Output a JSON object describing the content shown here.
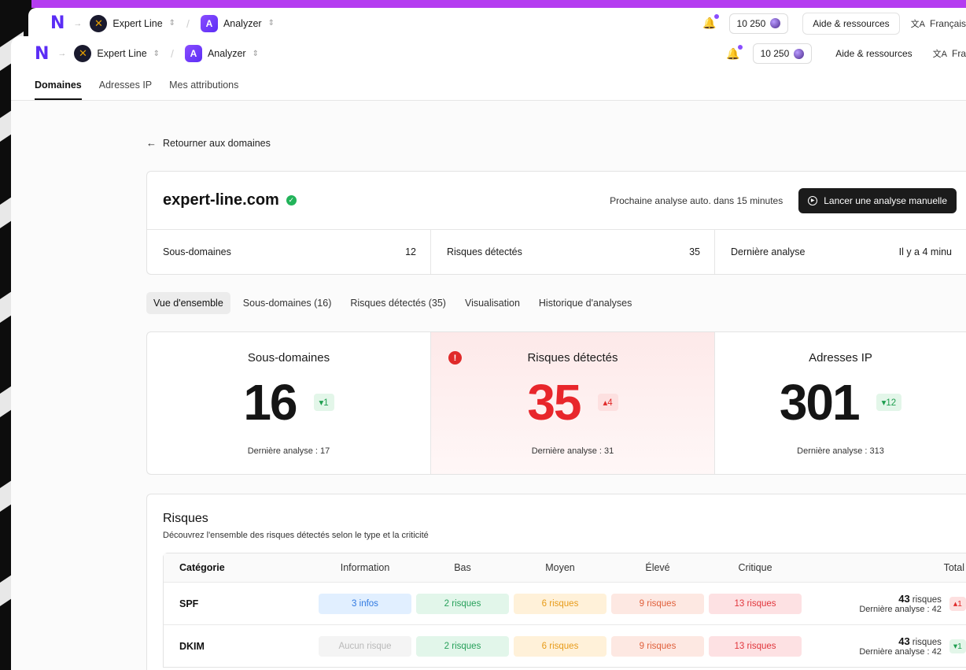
{
  "topbar": {
    "org": "Expert Line",
    "app": "Analyzer",
    "credits": "10 250",
    "help": "Aide & ressources",
    "language": "Français",
    "language_cut": "Fra"
  },
  "nav": {
    "tabs": [
      "Domaines",
      "Adresses IP",
      "Mes attributions"
    ]
  },
  "back_link": "Retourner aux domaines",
  "domain": {
    "name": "expert-line.com",
    "next_analysis": "Prochaine analyse auto. dans 15 minutes",
    "run_button": "Lancer une analyse manuelle",
    "stats": [
      {
        "label": "Sous-domaines",
        "value": "12"
      },
      {
        "label": "Risques détectés",
        "value": "35"
      },
      {
        "label": "Dernière analyse",
        "value": "Il y a 4 minu"
      }
    ]
  },
  "subtabs": [
    "Vue d'ensemble",
    "Sous-domaines (16)",
    "Risques détectés (35)",
    "Visualisation",
    "Historique d'analyses"
  ],
  "kpis": [
    {
      "title": "Sous-domaines",
      "value": "16",
      "delta": "▾1",
      "foot": "Dernière analyse : 17"
    },
    {
      "title": "Risques détectés",
      "value": "35",
      "delta": "▴4",
      "foot": "Dernière analyse : 31"
    },
    {
      "title": "Adresses IP",
      "value": "301",
      "delta": "▾12",
      "foot": "Dernière analyse : 313"
    }
  ],
  "risks": {
    "title": "Risques",
    "subtitle": "Découvrez l'ensemble des risques détectés selon le type et la criticité",
    "headers": [
      "Catégorie",
      "Information",
      "Bas",
      "Moyen",
      "Élevé",
      "Critique",
      "Total"
    ],
    "rows": [
      {
        "category": "SPF",
        "cells": [
          "3 infos",
          "2 risques",
          "6 risques",
          "9 risques",
          "13 risques"
        ],
        "total_value": "43",
        "total_unit": "risques",
        "total_foot": "Dernière analyse : 42",
        "delta": "▴1"
      },
      {
        "category": "DKIM",
        "cells": [
          "Aucun risque",
          "2 risques",
          "6 risques",
          "9 risques",
          "13 risques"
        ],
        "total_value": "43",
        "total_unit": "risques",
        "total_foot": "Dernière analyse : 42",
        "delta": "▾1"
      }
    ]
  },
  "colors": {
    "brand": "#5b2df5",
    "accent_bar": "#b43cf0",
    "danger": "#e8262b",
    "success": "#1f9e4f"
  }
}
